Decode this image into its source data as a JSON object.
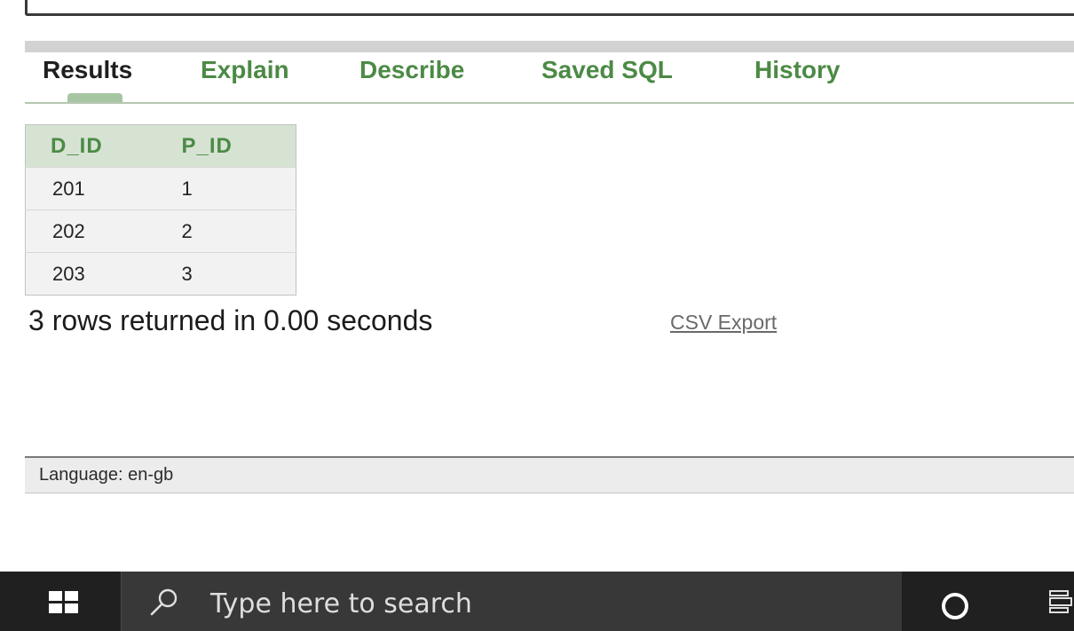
{
  "tabs": [
    {
      "label": "Results",
      "active": true
    },
    {
      "label": "Explain",
      "active": false
    },
    {
      "label": "Describe",
      "active": false
    },
    {
      "label": "Saved SQL",
      "active": false
    },
    {
      "label": "History",
      "active": false
    }
  ],
  "results_table": {
    "columns": [
      "D_ID",
      "P_ID"
    ],
    "rows": [
      [
        "201",
        "1"
      ],
      [
        "202",
        "2"
      ],
      [
        "203",
        "3"
      ]
    ]
  },
  "status_text": "3 rows returned in 0.00 seconds",
  "csv_export_label": "CSV Export",
  "language_label": "Language: en-gb",
  "taskbar": {
    "search_placeholder": "Type here to search",
    "icons": [
      "windows-logo",
      "search-icon",
      "cortana-icon",
      "task-view-icon"
    ]
  },
  "colors": {
    "tab_green": "#4c8a45",
    "header_bg": "#d6e3d3",
    "taskbar_bg": "#202020",
    "search_bg": "#383838"
  }
}
